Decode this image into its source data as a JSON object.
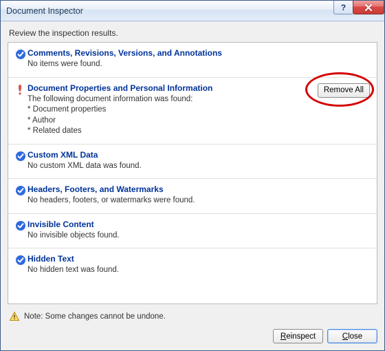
{
  "window": {
    "title": "Document Inspector"
  },
  "instruction": "Review the inspection results.",
  "sections": [
    {
      "title": "Comments, Revisions, Versions, and Annotations",
      "detail": "No items were found.",
      "status": "ok"
    },
    {
      "title": "Document Properties and Personal Information",
      "detail": "The following document information was found:\n* Document properties\n* Author\n* Related dates",
      "status": "alert",
      "action": "Remove All"
    },
    {
      "title": "Custom XML Data",
      "detail": "No custom XML data was found.",
      "status": "ok"
    },
    {
      "title": "Headers, Footers, and Watermarks",
      "detail": "No headers, footers, or watermarks were found.",
      "status": "ok"
    },
    {
      "title": "Invisible Content",
      "detail": "No invisible objects found.",
      "status": "ok"
    },
    {
      "title": "Hidden Text",
      "detail": "No hidden text was found.",
      "status": "ok"
    }
  ],
  "note": "Note: Some changes cannot be undone.",
  "buttons": {
    "reinspect": "Reinspect",
    "close": "Close"
  }
}
